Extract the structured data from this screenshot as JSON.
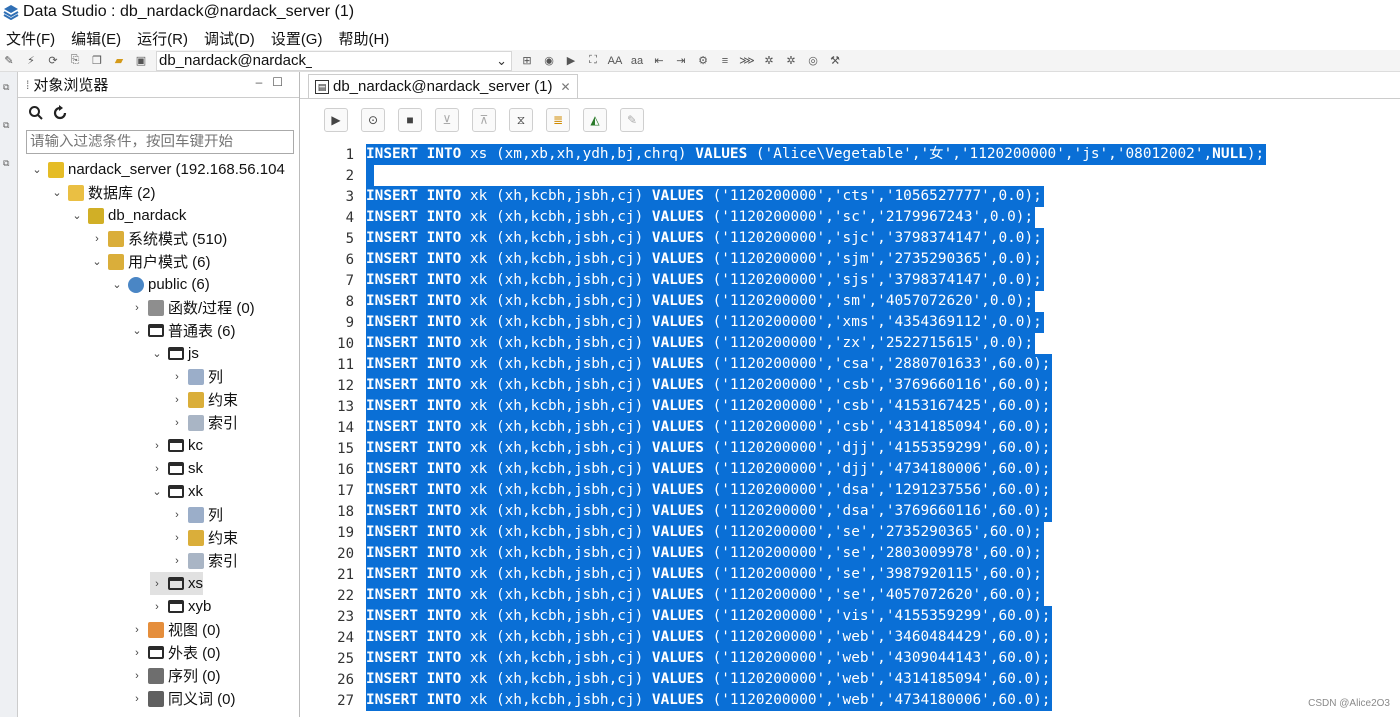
{
  "window": {
    "title": "Data Studio : db_nardack@nardack_server (1)"
  },
  "menu": [
    "文件(F)",
    "编辑(E)",
    "运行(R)",
    "调试(D)",
    "设置(G)",
    "帮助(H)"
  ],
  "toolbar": {
    "connection": "db_nardack@nardack_server",
    "icons": [
      "new-connection-icon",
      "disconnect-icon",
      "refresh-icon",
      "export-icon",
      "copy-icon",
      "open-folder-icon",
      "save-icon"
    ]
  },
  "explorer": {
    "tab_label": "对象浏览器",
    "filter_placeholder": "请输入过滤条件，按回车键开始",
    "tree": [
      {
        "label": "nardack_server (192.168.56.104",
        "depth": 0,
        "toggle": "v",
        "icon": "server-icon"
      },
      {
        "label": "数据库 (2)",
        "depth": 1,
        "toggle": "v",
        "icon": "database-folder-icon"
      },
      {
        "label": "db_nardack",
        "depth": 2,
        "toggle": "v",
        "icon": "database-icon"
      },
      {
        "label": "系统模式 (510)",
        "depth": 3,
        "toggle": ">",
        "icon": "system-schema-icon"
      },
      {
        "label": "用户模式 (6)",
        "depth": 3,
        "toggle": "v",
        "icon": "user-schema-icon"
      },
      {
        "label": "public (6)",
        "depth": 4,
        "toggle": "v",
        "icon": "schema-icon"
      },
      {
        "label": "函数/过程 (0)",
        "depth": 5,
        "toggle": ">",
        "icon": "function-icon"
      },
      {
        "label": "普通表 (6)",
        "depth": 5,
        "toggle": "v",
        "icon": "table-folder-icon"
      },
      {
        "label": "js",
        "depth": 6,
        "toggle": "v",
        "icon": "table-icon"
      },
      {
        "label": "列",
        "depth": 7,
        "toggle": ">",
        "icon": "column-icon"
      },
      {
        "label": "约束",
        "depth": 7,
        "toggle": ">",
        "icon": "constraint-icon"
      },
      {
        "label": "索引",
        "depth": 7,
        "toggle": ">",
        "icon": "index-icon"
      },
      {
        "label": "kc",
        "depth": 6,
        "toggle": ">",
        "icon": "table-icon"
      },
      {
        "label": "sk",
        "depth": 6,
        "toggle": ">",
        "icon": "table-icon"
      },
      {
        "label": "xk",
        "depth": 6,
        "toggle": "v",
        "icon": "table-icon"
      },
      {
        "label": "列",
        "depth": 7,
        "toggle": ">",
        "icon": "column-icon"
      },
      {
        "label": "约束",
        "depth": 7,
        "toggle": ">",
        "icon": "constraint-icon"
      },
      {
        "label": "索引",
        "depth": 7,
        "toggle": ">",
        "icon": "index-icon"
      },
      {
        "label": "xs",
        "depth": 6,
        "toggle": ">",
        "icon": "table-icon",
        "selected": true
      },
      {
        "label": "xyb",
        "depth": 6,
        "toggle": ">",
        "icon": "table-icon"
      },
      {
        "label": "视图 (0)",
        "depth": 5,
        "toggle": ">",
        "icon": "view-icon"
      },
      {
        "label": "外表 (0)",
        "depth": 5,
        "toggle": ">",
        "icon": "foreign-table-icon"
      },
      {
        "label": "序列 (0)",
        "depth": 5,
        "toggle": ">",
        "icon": "sequence-icon"
      },
      {
        "label": "同义词 (0)",
        "depth": 5,
        "toggle": ">",
        "icon": "synonym-icon"
      }
    ]
  },
  "editor": {
    "tab_label": "db_nardack@nardack_server (1)",
    "toolbar_icons": [
      "execute-icon",
      "execute-step-icon",
      "stop-icon",
      "commit-icon",
      "rollback-icon",
      "history-icon",
      "format-icon",
      "explain-plan-icon",
      "edit-icon"
    ],
    "lines": [
      {
        "n": "1",
        "segs": [
          [
            "INSERT INTO",
            1
          ],
          [
            " xs (xm,xb,xh,ydh,bj,chrq) ",
            0
          ],
          [
            "VALUES",
            1
          ],
          [
            " ('Alice\\Vegetable','女','1120200000','js','08012002',",
            0
          ],
          [
            "NULL",
            1
          ],
          [
            ");",
            0
          ]
        ]
      },
      {
        "n": "2",
        "segs": []
      },
      {
        "n": "3",
        "segs": [
          [
            "INSERT INTO",
            1
          ],
          [
            " xk (xh,kcbh,jsbh,cj) ",
            0
          ],
          [
            "VALUES",
            1
          ],
          [
            " ('1120200000','cts','1056527777',0.0);",
            0
          ]
        ]
      },
      {
        "n": "4",
        "segs": [
          [
            "INSERT INTO",
            1
          ],
          [
            " xk (xh,kcbh,jsbh,cj) ",
            0
          ],
          [
            "VALUES",
            1
          ],
          [
            " ('1120200000','sc','2179967243',0.0);",
            0
          ]
        ]
      },
      {
        "n": "5",
        "segs": [
          [
            "INSERT INTO",
            1
          ],
          [
            " xk (xh,kcbh,jsbh,cj) ",
            0
          ],
          [
            "VALUES",
            1
          ],
          [
            " ('1120200000','sjc','3798374147',0.0);",
            0
          ]
        ]
      },
      {
        "n": "6",
        "segs": [
          [
            "INSERT INTO",
            1
          ],
          [
            " xk (xh,kcbh,jsbh,cj) ",
            0
          ],
          [
            "VALUES",
            1
          ],
          [
            " ('1120200000','sjm','2735290365',0.0);",
            0
          ]
        ]
      },
      {
        "n": "7",
        "segs": [
          [
            "INSERT INTO",
            1
          ],
          [
            " xk (xh,kcbh,jsbh,cj) ",
            0
          ],
          [
            "VALUES",
            1
          ],
          [
            " ('1120200000','sjs','3798374147',0.0);",
            0
          ]
        ]
      },
      {
        "n": "8",
        "segs": [
          [
            "INSERT INTO",
            1
          ],
          [
            " xk (xh,kcbh,jsbh,cj) ",
            0
          ],
          [
            "VALUES",
            1
          ],
          [
            " ('1120200000','sm','4057072620',0.0);",
            0
          ]
        ]
      },
      {
        "n": "9",
        "segs": [
          [
            "INSERT INTO",
            1
          ],
          [
            " xk (xh,kcbh,jsbh,cj) ",
            0
          ],
          [
            "VALUES",
            1
          ],
          [
            " ('1120200000','xms','4354369112',0.0);",
            0
          ]
        ]
      },
      {
        "n": "10",
        "segs": [
          [
            "INSERT INTO",
            1
          ],
          [
            " xk (xh,kcbh,jsbh,cj) ",
            0
          ],
          [
            "VALUES",
            1
          ],
          [
            " ('1120200000','zx','2522715615',0.0);",
            0
          ]
        ]
      },
      {
        "n": "11",
        "segs": [
          [
            "INSERT INTO",
            1
          ],
          [
            " xk (xh,kcbh,jsbh,cj) ",
            0
          ],
          [
            "VALUES",
            1
          ],
          [
            " ('1120200000','csa','2880701633',60.0);",
            0
          ]
        ]
      },
      {
        "n": "12",
        "segs": [
          [
            "INSERT INTO",
            1
          ],
          [
            " xk (xh,kcbh,jsbh,cj) ",
            0
          ],
          [
            "VALUES",
            1
          ],
          [
            " ('1120200000','csb','3769660116',60.0);",
            0
          ]
        ]
      },
      {
        "n": "13",
        "segs": [
          [
            "INSERT INTO",
            1
          ],
          [
            " xk (xh,kcbh,jsbh,cj) ",
            0
          ],
          [
            "VALUES",
            1
          ],
          [
            " ('1120200000','csb','4153167425',60.0);",
            0
          ]
        ]
      },
      {
        "n": "14",
        "segs": [
          [
            "INSERT INTO",
            1
          ],
          [
            " xk (xh,kcbh,jsbh,cj) ",
            0
          ],
          [
            "VALUES",
            1
          ],
          [
            " ('1120200000','csb','4314185094',60.0);",
            0
          ]
        ]
      },
      {
        "n": "15",
        "segs": [
          [
            "INSERT INTO",
            1
          ],
          [
            " xk (xh,kcbh,jsbh,cj) ",
            0
          ],
          [
            "VALUES",
            1
          ],
          [
            " ('1120200000','djj','4155359299',60.0);",
            0
          ]
        ]
      },
      {
        "n": "16",
        "segs": [
          [
            "INSERT INTO",
            1
          ],
          [
            " xk (xh,kcbh,jsbh,cj) ",
            0
          ],
          [
            "VALUES",
            1
          ],
          [
            " ('1120200000','djj','4734180006',60.0);",
            0
          ]
        ]
      },
      {
        "n": "17",
        "segs": [
          [
            "INSERT INTO",
            1
          ],
          [
            " xk (xh,kcbh,jsbh,cj) ",
            0
          ],
          [
            "VALUES",
            1
          ],
          [
            " ('1120200000','dsa','1291237556',60.0);",
            0
          ]
        ]
      },
      {
        "n": "18",
        "segs": [
          [
            "INSERT INTO",
            1
          ],
          [
            " xk (xh,kcbh,jsbh,cj) ",
            0
          ],
          [
            "VALUES",
            1
          ],
          [
            " ('1120200000','dsa','3769660116',60.0);",
            0
          ]
        ]
      },
      {
        "n": "19",
        "segs": [
          [
            "INSERT INTO",
            1
          ],
          [
            " xk (xh,kcbh,jsbh,cj) ",
            0
          ],
          [
            "VALUES",
            1
          ],
          [
            " ('1120200000','se','2735290365',60.0);",
            0
          ]
        ]
      },
      {
        "n": "20",
        "segs": [
          [
            "INSERT INTO",
            1
          ],
          [
            " xk (xh,kcbh,jsbh,cj) ",
            0
          ],
          [
            "VALUES",
            1
          ],
          [
            " ('1120200000','se','2803009978',60.0);",
            0
          ]
        ]
      },
      {
        "n": "21",
        "segs": [
          [
            "INSERT INTO",
            1
          ],
          [
            " xk (xh,kcbh,jsbh,cj) ",
            0
          ],
          [
            "VALUES",
            1
          ],
          [
            " ('1120200000','se','3987920115',60.0);",
            0
          ]
        ]
      },
      {
        "n": "22",
        "segs": [
          [
            "INSERT INTO",
            1
          ],
          [
            " xk (xh,kcbh,jsbh,cj) ",
            0
          ],
          [
            "VALUES",
            1
          ],
          [
            " ('1120200000','se','4057072620',60.0);",
            0
          ]
        ]
      },
      {
        "n": "23",
        "segs": [
          [
            "INSERT INTO",
            1
          ],
          [
            " xk (xh,kcbh,jsbh,cj) ",
            0
          ],
          [
            "VALUES",
            1
          ],
          [
            " ('1120200000','vis','4155359299',60.0);",
            0
          ]
        ]
      },
      {
        "n": "24",
        "segs": [
          [
            "INSERT INTO",
            1
          ],
          [
            " xk (xh,kcbh,jsbh,cj) ",
            0
          ],
          [
            "VALUES",
            1
          ],
          [
            " ('1120200000','web','3460484429',60.0);",
            0
          ]
        ]
      },
      {
        "n": "25",
        "segs": [
          [
            "INSERT INTO",
            1
          ],
          [
            " xk (xh,kcbh,jsbh,cj) ",
            0
          ],
          [
            "VALUES",
            1
          ],
          [
            " ('1120200000','web','4309044143',60.0);",
            0
          ]
        ]
      },
      {
        "n": "26",
        "segs": [
          [
            "INSERT INTO",
            1
          ],
          [
            " xk (xh,kcbh,jsbh,cj) ",
            0
          ],
          [
            "VALUES",
            1
          ],
          [
            " ('1120200000','web','4314185094',60.0);",
            0
          ]
        ]
      },
      {
        "n": "27",
        "segs": [
          [
            "INSERT INTO",
            1
          ],
          [
            " xk (xh,kcbh,jsbh,cj) ",
            0
          ],
          [
            "VALUES",
            1
          ],
          [
            " ('1120200000','web','4734180006',60.0);",
            0
          ]
        ]
      }
    ]
  },
  "colors": {
    "selection": "#0a6fd6",
    "toolbar_bg": "#f4f4f4"
  },
  "watermark": "CSDN @Alice2O3"
}
